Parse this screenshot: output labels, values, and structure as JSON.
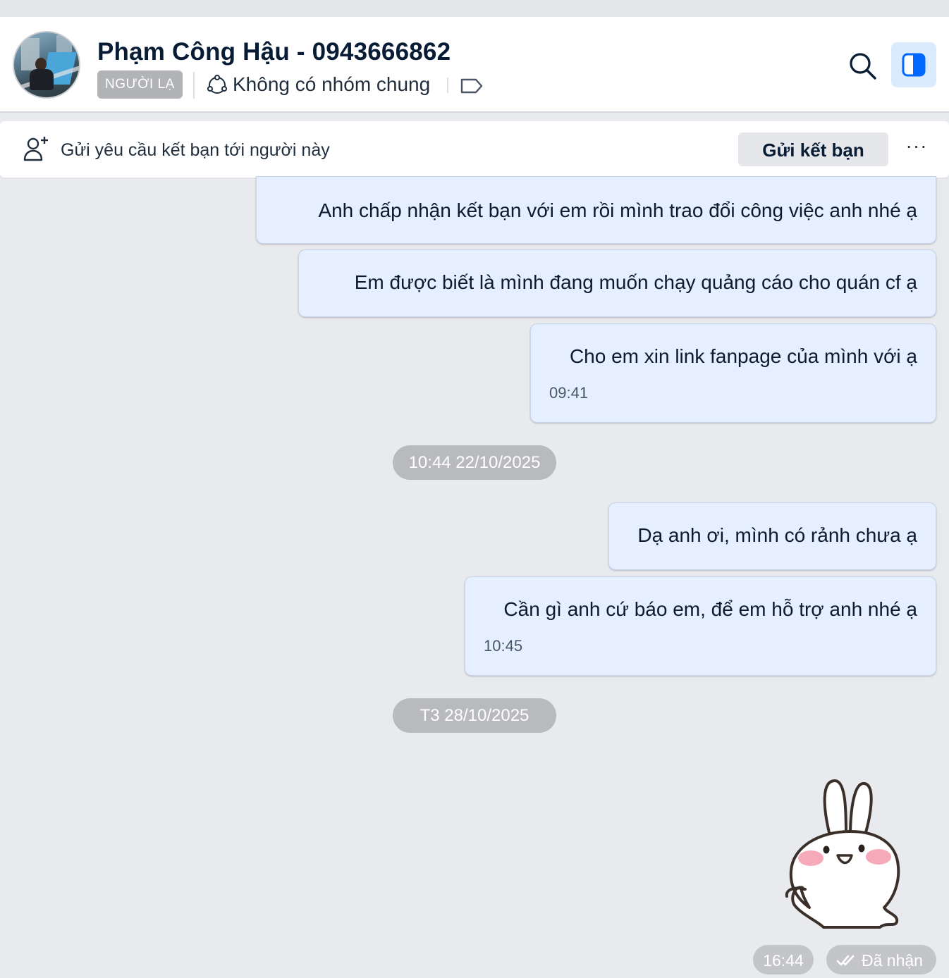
{
  "header": {
    "contact_name": "Phạm Công Hậu - 0943666862",
    "stranger_badge": "NGƯỜI LẠ",
    "common_groups": "Không có nhóm chung"
  },
  "friend_request_bar": {
    "text": "Gửi yêu cầu kết bạn tới người này",
    "button_label": "Gửi kết bạn",
    "more_label": "···"
  },
  "messages": [
    {
      "text": "Anh chấp nhận kết bạn với em rồi mình trao đổi công việc anh nhé ạ",
      "time": ""
    },
    {
      "text": "Em được biết là mình đang muốn chạy quảng cáo cho quán cf ạ",
      "time": ""
    },
    {
      "text": "Cho em xin link fanpage của mình với ạ",
      "time": "09:41"
    },
    {
      "text": "Dạ anh ơi, mình có rảnh chưa ạ",
      "time": ""
    },
    {
      "text": "Cần gì anh cứ báo em, để em hỗ trợ anh nhé ạ",
      "time": "10:45"
    }
  ],
  "date_separators": [
    "10:44 22/10/2025",
    "T3 28/10/2025"
  ],
  "sticker": {
    "icon": "bunny-sticker",
    "time": "16:44",
    "status": "Đã nhận"
  },
  "colors": {
    "background": "#e9eaee",
    "bubble": "#e5efff",
    "accent": "#0068ff",
    "badge": "#b1b3b7"
  }
}
